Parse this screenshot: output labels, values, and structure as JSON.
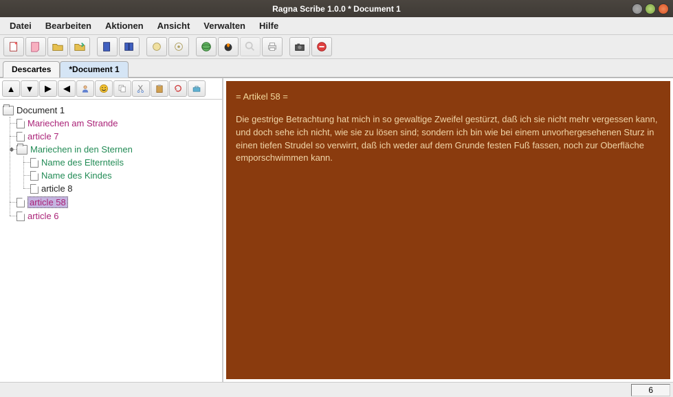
{
  "window": {
    "title": "Ragna Scribe 1.0.0  * Document 1"
  },
  "menubar": {
    "items": [
      "Datei",
      "Bearbeiten",
      "Aktionen",
      "Ansicht",
      "Verwalten",
      "Hilfe"
    ]
  },
  "tabs": [
    {
      "label": "Descartes",
      "active": false
    },
    {
      "label": "*Document 1",
      "active": true
    }
  ],
  "tree": {
    "root": {
      "label": "Document 1",
      "children": [
        {
          "label": "Mariechen am Strande",
          "style": "link"
        },
        {
          "label": "article 7",
          "style": "link"
        },
        {
          "label": "Mariechen in den Sternen",
          "style": "green",
          "expanded": true,
          "children": [
            {
              "label": "Name des Elternteils",
              "style": "green"
            },
            {
              "label": "Name des Kindes",
              "style": "green"
            },
            {
              "label": "article 8",
              "style": "plain"
            }
          ]
        },
        {
          "label": "article 58",
          "style": "link",
          "selected": true
        },
        {
          "label": "article 6",
          "style": "link"
        }
      ]
    }
  },
  "editor": {
    "heading": "= Artikel 58 =",
    "body": "Die gestrige Betrachtung hat mich in so gewaltige Zweifel gestürzt, daß ich sie nicht mehr vergessen kann, und doch sehe ich nicht, wie sie zu lösen sind; sondern ich bin wie bei einem unvorhergesehenen Sturz in einen tiefen Strudel so verwirrt, daß ich weder auf dem Grunde festen Fuß fassen, noch zur Oberfläche emporschwimmen kann."
  },
  "status": {
    "value": "6"
  },
  "colors": {
    "editor_bg": "#8a3b0e",
    "editor_fg": "#f0d5a8"
  }
}
